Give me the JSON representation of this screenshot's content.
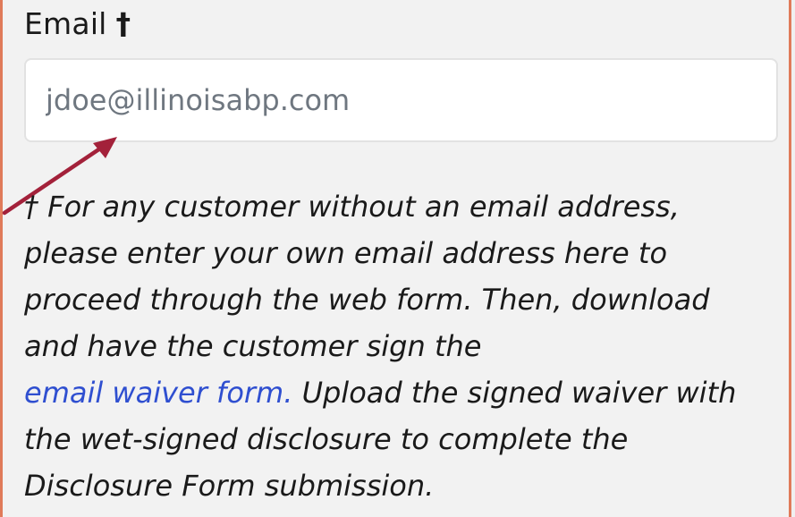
{
  "form": {
    "email_label": "Email",
    "email_marker": "†",
    "email_placeholder": "jdoe@illinoisabp.com",
    "note": {
      "line1": "† For any customer without an email address,",
      "line2": "please enter your own email address here to",
      "line3": "proceed through the web form. Then, download",
      "line4": "and have the customer sign the",
      "link_text": "email waiver form.",
      "line5_after": " Upload the signed waiver with",
      "line6": "the wet-signed disclosure to complete the",
      "line7": "Disclosure Form submission."
    }
  },
  "colors": {
    "border_accent": "#e07b5a",
    "arrow": "#a3213a",
    "link": "#2f4fd0",
    "placeholder": "#6f7780"
  },
  "icons": {
    "annotation": "arrow-pointer-icon"
  }
}
